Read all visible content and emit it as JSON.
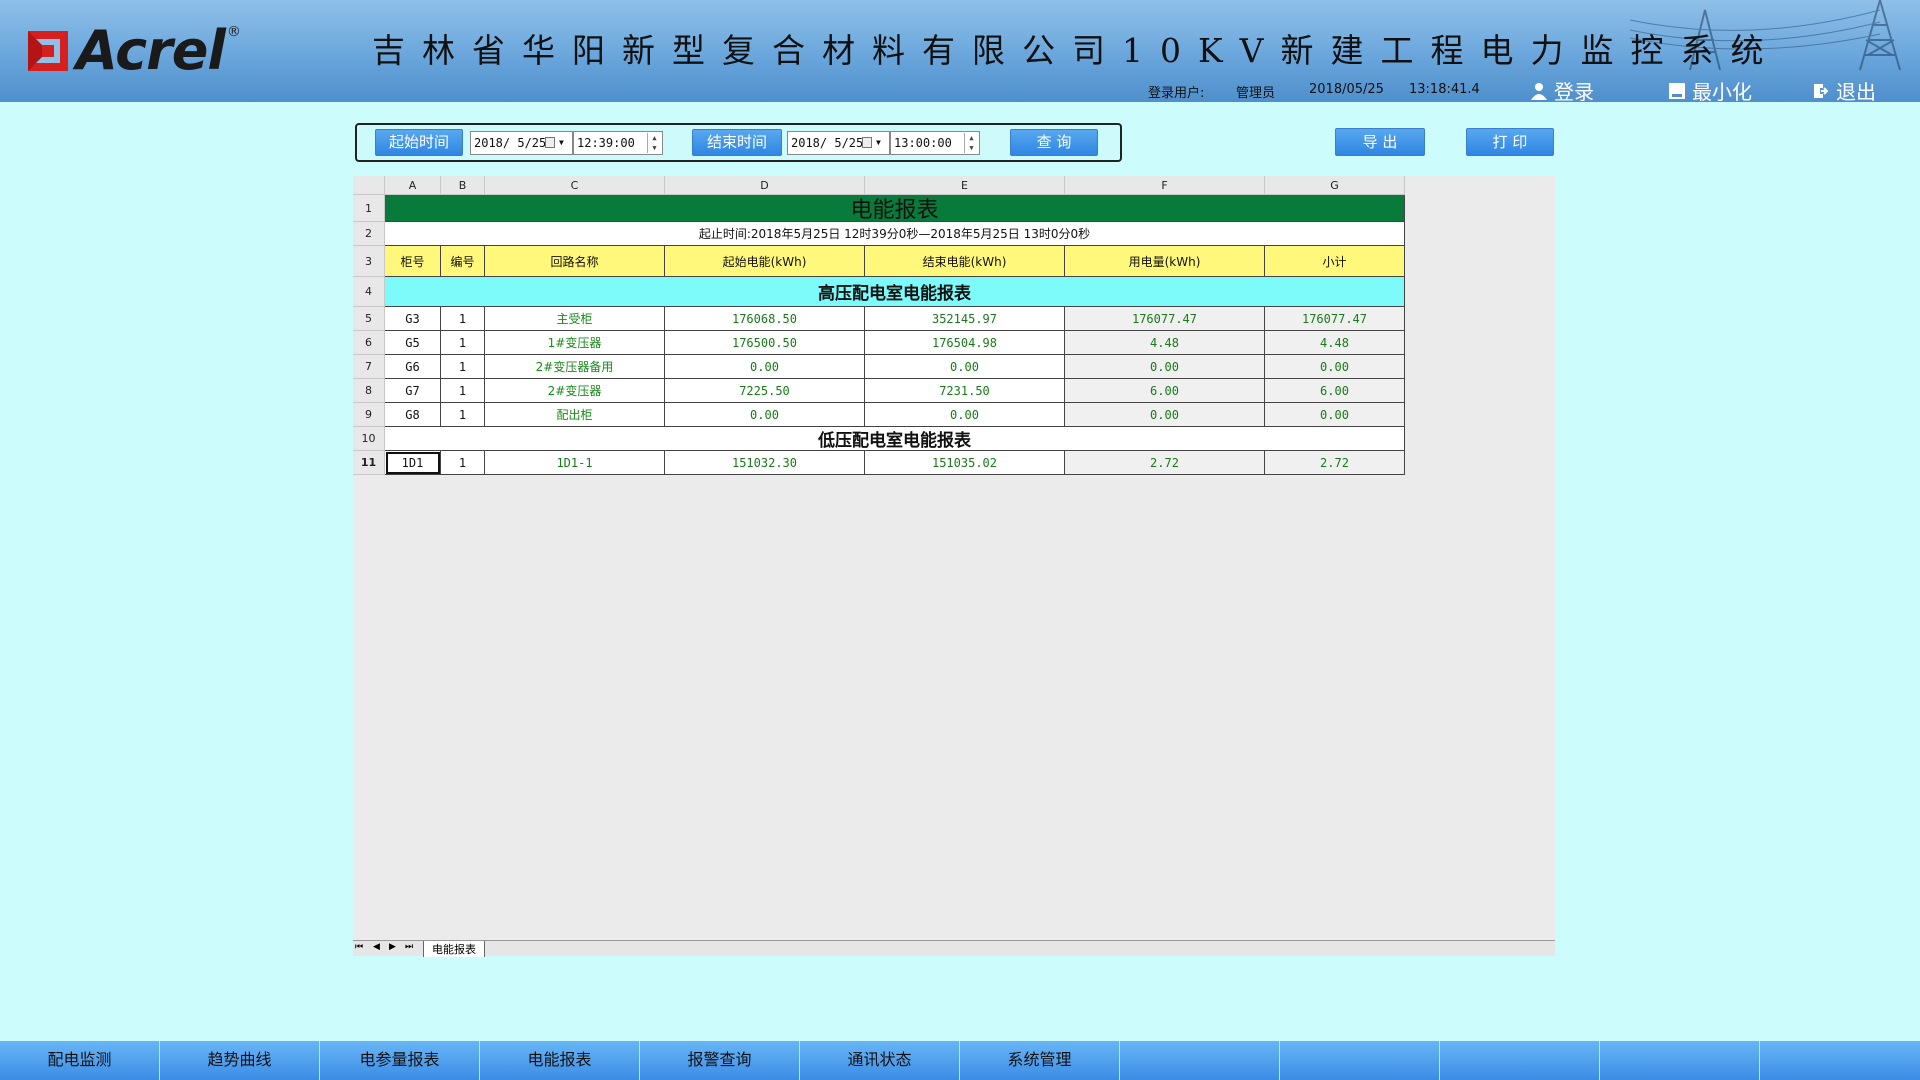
{
  "header": {
    "logo_text": "Acrel",
    "logo_reg": "®",
    "title": "吉林省华阳新型复合材料有限公司10KV新建工程电力监控系统",
    "login_user_label": "登录用户:",
    "user": "管理员",
    "date": "2018/05/25",
    "time": "13:18:41.4",
    "login_label": "登录",
    "minimize_label": "最小化",
    "exit_label": "退出"
  },
  "query": {
    "start_label": "起始时间",
    "start_date": "2018/ 5/25",
    "start_time": "12:39:00",
    "end_label": "结束时间",
    "end_date": "2018/ 5/25",
    "end_time": "13:00:00",
    "search_label": "查 询",
    "export_label": "导 出",
    "print_label": "打 印"
  },
  "sheet": {
    "columns": [
      "A",
      "B",
      "C",
      "D",
      "E",
      "F",
      "G"
    ],
    "rows": [
      "1",
      "2",
      "3",
      "4",
      "5",
      "6",
      "7",
      "8",
      "9",
      "10",
      "11"
    ],
    "title": "电能报表",
    "range": "起止时间:2018年5月25日 12时39分0秒—2018年5月25日 13时0分0秒",
    "headers": [
      "柜号",
      "编号",
      "回路名称",
      "起始电能(kWh)",
      "结束电能(kWh)",
      "用电量(kWh)",
      "小计"
    ],
    "section_high": "高压配电室电能报表",
    "section_low": "低压配电室电能报表",
    "data": [
      [
        "G3",
        "1",
        "主受柜",
        "176068.50",
        "352145.97",
        "176077.47",
        "176077.47"
      ],
      [
        "G5",
        "1",
        "1#变压器",
        "176500.50",
        "176504.98",
        "4.48",
        "4.48"
      ],
      [
        "G6",
        "1",
        "2#变压器备用",
        "0.00",
        "0.00",
        "0.00",
        "0.00"
      ],
      [
        "G7",
        "1",
        "2#变压器",
        "7225.50",
        "7231.50",
        "6.00",
        "6.00"
      ],
      [
        "G8",
        "1",
        "配出柜",
        "0.00",
        "0.00",
        "0.00",
        "0.00"
      ]
    ],
    "low_data": [
      [
        "1D1",
        "1",
        "1D1-1",
        "151032.30",
        "151035.02",
        "2.72",
        "2.72"
      ]
    ],
    "tab_name": "电能报表",
    "nav_glyphs": [
      "⏮",
      "◀",
      "▶",
      "⏭"
    ]
  },
  "nav": {
    "items": [
      "配电监测",
      "趋势曲线",
      "电参量报表",
      "电能报表",
      "报警查询",
      "通讯状态",
      "系统管理",
      "",
      "",
      "",
      "",
      ""
    ]
  }
}
